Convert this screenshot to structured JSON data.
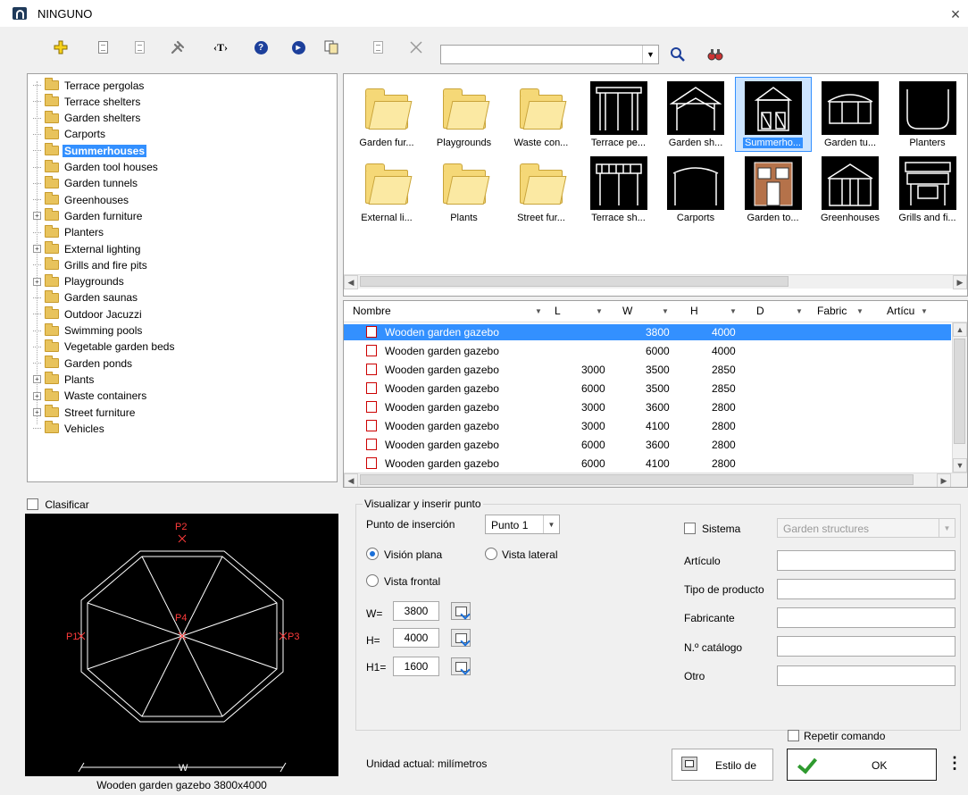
{
  "window": {
    "title": "NINGUNO",
    "close_label": "×"
  },
  "toolbar": {
    "icons": [
      "add-icon",
      "properties-icon",
      "list-icon",
      "tools-icon",
      "text-tag-icon",
      "help-icon",
      "play-icon",
      "copy-icon",
      "details-icon",
      "delete-icon"
    ],
    "search_value": "",
    "search_icon": "magnifier-icon",
    "find_icon": "binoculars-icon"
  },
  "tree": {
    "items": [
      {
        "label": "Terrace pergolas",
        "expandable": false
      },
      {
        "label": "Terrace shelters",
        "expandable": false
      },
      {
        "label": "Garden shelters",
        "expandable": false
      },
      {
        "label": "Carports",
        "expandable": false
      },
      {
        "label": "Summerhouses",
        "expandable": false,
        "selected": true
      },
      {
        "label": "Garden tool houses",
        "expandable": false
      },
      {
        "label": "Garden tunnels",
        "expandable": false
      },
      {
        "label": "Greenhouses",
        "expandable": false
      },
      {
        "label": "Garden furniture",
        "expandable": true
      },
      {
        "label": "Planters",
        "expandable": false
      },
      {
        "label": "External lighting",
        "expandable": true
      },
      {
        "label": "Grills and fire pits",
        "expandable": false
      },
      {
        "label": "Playgrounds",
        "expandable": true
      },
      {
        "label": "Garden saunas",
        "expandable": false
      },
      {
        "label": "Outdoor Jacuzzi",
        "expandable": false
      },
      {
        "label": "Swimming pools",
        "expandable": false
      },
      {
        "label": "Vegetable garden beds",
        "expandable": false
      },
      {
        "label": "Garden ponds",
        "expandable": false
      },
      {
        "label": "Plants",
        "expandable": true
      },
      {
        "label": "Waste containers",
        "expandable": true
      },
      {
        "label": "Street furniture",
        "expandable": true
      },
      {
        "label": "Vehicles",
        "expandable": false
      }
    ]
  },
  "tiles": {
    "row1": [
      {
        "label": "Garden fur...",
        "kind": "folder"
      },
      {
        "label": "Playgrounds",
        "kind": "folder"
      },
      {
        "label": "Waste con...",
        "kind": "folder"
      },
      {
        "label": "Terrace pe...",
        "kind": "pergola"
      },
      {
        "label": "Garden sh...",
        "kind": "shelter"
      },
      {
        "label": "Summerho...",
        "kind": "summerhouse",
        "selected": true
      },
      {
        "label": "Garden tu...",
        "kind": "tunnel"
      },
      {
        "label": "Planters",
        "kind": "planter"
      }
    ],
    "row2": [
      {
        "label": "External li...",
        "kind": "folder"
      },
      {
        "label": "Plants",
        "kind": "folder"
      },
      {
        "label": "Street fur...",
        "kind": "folder"
      },
      {
        "label": "Terrace sh...",
        "kind": "terrace-shelter"
      },
      {
        "label": "Carports",
        "kind": "carport"
      },
      {
        "label": "Garden to...",
        "kind": "toolhouse"
      },
      {
        "label": "Greenhouses",
        "kind": "greenhouse"
      },
      {
        "label": "Grills and fi...",
        "kind": "grill"
      }
    ]
  },
  "table": {
    "columns": [
      "Nombre",
      "L",
      "W",
      "H",
      "D",
      "Fabric",
      "Artícu"
    ],
    "rows": [
      {
        "name": "Wooden garden gazebo",
        "L": "",
        "W": "3800",
        "H": "4000",
        "D": "",
        "selected": true
      },
      {
        "name": "Wooden garden gazebo",
        "L": "",
        "W": "6000",
        "H": "4000",
        "D": ""
      },
      {
        "name": "Wooden garden gazebo",
        "L": "3000",
        "W": "3500",
        "H": "2850",
        "D": ""
      },
      {
        "name": "Wooden garden gazebo",
        "L": "6000",
        "W": "3500",
        "H": "2850",
        "D": ""
      },
      {
        "name": "Wooden garden gazebo",
        "L": "3000",
        "W": "3600",
        "H": "2800",
        "D": ""
      },
      {
        "name": "Wooden garden gazebo",
        "L": "3000",
        "W": "4100",
        "H": "2800",
        "D": ""
      },
      {
        "name": "Wooden garden gazebo",
        "L": "6000",
        "W": "3600",
        "H": "2800",
        "D": ""
      },
      {
        "name": "Wooden garden gazebo",
        "L": "6000",
        "W": "4100",
        "H": "2800",
        "D": ""
      }
    ]
  },
  "classify": {
    "label": "Clasificar",
    "checked": false
  },
  "preview": {
    "caption": "Wooden garden gazebo 3800x4000",
    "points": [
      "P1",
      "P2",
      "P3",
      "P4"
    ],
    "dim_label": "W"
  },
  "options": {
    "legend": "Visualizar y inserir punto",
    "insert_point_label": "Punto de inserción",
    "insert_point_value": "Punto 1",
    "plan_view_label": "Visión plana",
    "side_view_label": "Vista lateral",
    "front_view_label": "Vista frontal",
    "view_selected": "plan",
    "w_label": "W=",
    "w_value": "3800",
    "h_label": "H=",
    "h_value": "4000",
    "h1_label": "H1=",
    "h1_value": "1600",
    "system_label": "Sistema",
    "system_checked": false,
    "system_value": "Garden structures",
    "article_label": "Artículo",
    "product_type_label": "Tipo de producto",
    "manufacturer_label": "Fabricante",
    "catalog_label": "N.º catálogo",
    "other_label": "Otro"
  },
  "footer": {
    "unit_label": "Unidad actual: milímetros",
    "repeat_label": "Repetir comando",
    "style_label": "Estilo de",
    "ok_label": "OK",
    "more_label": "⋮"
  },
  "colors": {
    "selection": "#3390ff",
    "accent_blue": "#1c3f9b",
    "cad_red": "#ff3b3b"
  }
}
